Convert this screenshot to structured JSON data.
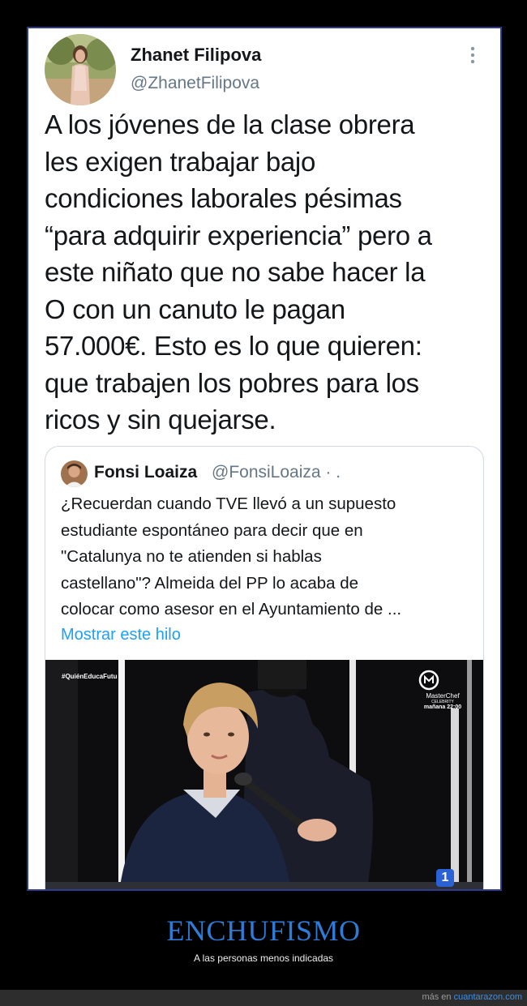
{
  "tweet": {
    "author_name": "Zhanet Filipova",
    "author_handle": "@ZhanetFilipova",
    "text_lines": [
      "A los jóvenes de la clase obrera",
      "les exigen trabajar bajo",
      "condiciones laborales pésimas",
      "“para adquirir experiencia” pero a",
      "este niñato que no sabe hacer la",
      "O con un canuto le pagan",
      "57.000€. Esto es lo que quieren:",
      "que trabajen los pobres para los",
      "ricos y sin quejarse."
    ],
    "more_icon": "vertical-dots-icon"
  },
  "quote": {
    "author_name": "Fonsi Loaiza",
    "author_handle": "@FonsiLoaiza · .",
    "text_lines": [
      "¿Recuerdan cuando TVE llevó a un supuesto",
      "estudiante espontáneo para decir que en",
      "\"Catalunya no te atienden si hablas",
      "castellano\"? Almeida del PP lo acaba de",
      "colocar como asesor en el Ayuntamiento de ..."
    ],
    "show_thread_link": "Mostrar este hilo",
    "media": {
      "hashtag": "#QuiénEducaFutu",
      "logo_title": "MasterChef",
      "logo_sub": "CELEBRITY",
      "logo_time": "mañana 22:00",
      "channel": "1"
    }
  },
  "footer": {
    "title": "ENCHUFISMO",
    "subtitle": "A las personas menos indicadas",
    "credit_prefix": "más en",
    "credit_site": "cuantarazon.com"
  },
  "colors": {
    "frame_border": "#2c3c8e",
    "link": "#1da1f2",
    "title": "#2e7cd8"
  }
}
